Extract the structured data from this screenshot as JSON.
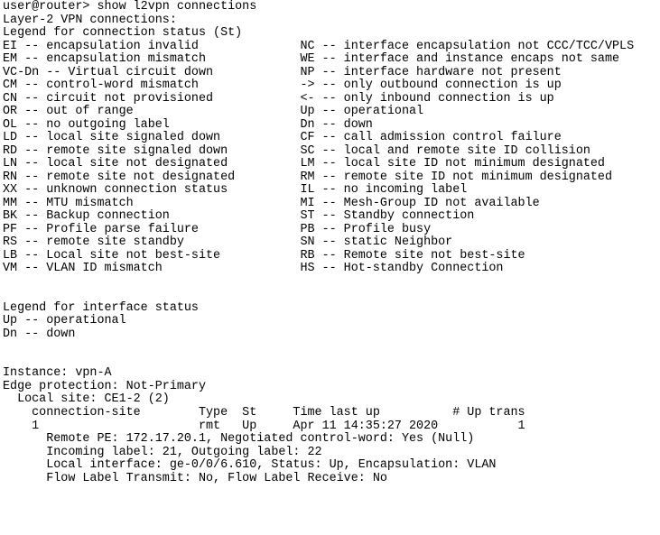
{
  "terminal": {
    "prompt": "user@router>",
    "command": "show l2vpn connections",
    "title": "Layer-2 VPN connections:",
    "lines": [
      "user@router> show l2vpn connections",
      "Layer-2 VPN connections:",
      "Legend for connection status (St)",
      "EI -- encapsulation invalid              NC -- interface encapsulation not CCC/TCC/VPLS",
      "EM -- encapsulation mismatch             WE -- interface and instance encaps not same",
      "VC-Dn -- Virtual circuit down            NP -- interface hardware not present",
      "CM -- control-word mismatch              -> -- only outbound connection is up",
      "CN -- circuit not provisioned            <- -- only inbound connection is up",
      "OR -- out of range                       Up -- operational",
      "OL -- no outgoing label                  Dn -- down",
      "LD -- local site signaled down           CF -- call admission control failure",
      "RD -- remote site signaled down          SC -- local and remote site ID collision",
      "LN -- local site not designated          LM -- local site ID not minimum designated",
      "RN -- remote site not designated         RM -- remote site ID not minimum designated",
      "XX -- unknown connection status          IL -- no incoming label",
      "MM -- MTU mismatch                       MI -- Mesh-Group ID not available",
      "BK -- Backup connection                  ST -- Standby connection",
      "PF -- Profile parse failure              PB -- Profile busy",
      "RS -- remote site standby                SN -- static Neighbor",
      "LB -- Local site not best-site           RB -- Remote site not best-site",
      "VM -- VLAN ID mismatch                   HS -- Hot-standby Connection",
      "",
      "",
      "Legend for interface status",
      "Up -- operational",
      "Dn -- down",
      "",
      "",
      "Instance: vpn-A",
      "Edge protection: Not-Primary",
      "  Local site: CE1-2 (2)",
      "    connection-site        Type  St     Time last up          # Up trans",
      "    1                      rmt   Up     Apr 11 14:35:27 2020           1",
      "      Remote PE: 172.17.20.1, Negotiated control-word: Yes (Null)",
      "      Incoming label: 21, Outgoing label: 22",
      "      Local interface: ge-0/0/6.610, Status: Up, Encapsulation: VLAN",
      "      Flow Label Transmit: No, Flow Label Receive: No"
    ]
  },
  "connection_status_legend": {
    "heading": "Legend for connection status (St)",
    "left_column": [
      {
        "code": "EI",
        "description": "encapsulation invalid"
      },
      {
        "code": "EM",
        "description": "encapsulation mismatch"
      },
      {
        "code": "VC-Dn",
        "description": "Virtual circuit down"
      },
      {
        "code": "CM",
        "description": "control-word mismatch"
      },
      {
        "code": "CN",
        "description": "circuit not provisioned"
      },
      {
        "code": "OR",
        "description": "out of range"
      },
      {
        "code": "OL",
        "description": "no outgoing label"
      },
      {
        "code": "LD",
        "description": "local site signaled down"
      },
      {
        "code": "RD",
        "description": "remote site signaled down"
      },
      {
        "code": "LN",
        "description": "local site not designated"
      },
      {
        "code": "RN",
        "description": "remote site not designated"
      },
      {
        "code": "XX",
        "description": "unknown connection status"
      },
      {
        "code": "MM",
        "description": "MTU mismatch"
      },
      {
        "code": "BK",
        "description": "Backup connection"
      },
      {
        "code": "PF",
        "description": "Profile parse failure"
      },
      {
        "code": "RS",
        "description": "remote site standby"
      },
      {
        "code": "LB",
        "description": "Local site not best-site"
      },
      {
        "code": "VM",
        "description": "VLAN ID mismatch"
      }
    ],
    "right_column": [
      {
        "code": "NC",
        "description": "interface encapsulation not CCC/TCC/VPLS"
      },
      {
        "code": "WE",
        "description": "interface and instance encaps not same"
      },
      {
        "code": "NP",
        "description": "interface hardware not present"
      },
      {
        "code": "->",
        "description": "only outbound connection is up"
      },
      {
        "code": "<-",
        "description": "only inbound connection is up"
      },
      {
        "code": "Up",
        "description": "operational"
      },
      {
        "code": "Dn",
        "description": "down"
      },
      {
        "code": "CF",
        "description": "call admission control failure"
      },
      {
        "code": "SC",
        "description": "local and remote site ID collision"
      },
      {
        "code": "LM",
        "description": "local site ID not minimum designated"
      },
      {
        "code": "RM",
        "description": "remote site ID not minimum designated"
      },
      {
        "code": "IL",
        "description": "no incoming label"
      },
      {
        "code": "MI",
        "description": "Mesh-Group ID not available"
      },
      {
        "code": "ST",
        "description": "Standby connection"
      },
      {
        "code": "PB",
        "description": "Profile busy"
      },
      {
        "code": "SN",
        "description": "static Neighbor"
      },
      {
        "code": "RB",
        "description": "Remote site not best-site"
      },
      {
        "code": "HS",
        "description": "Hot-standby Connection"
      }
    ]
  },
  "interface_status_legend": {
    "heading": "Legend for interface status",
    "entries": [
      {
        "code": "Up",
        "description": "operational"
      },
      {
        "code": "Dn",
        "description": "down"
      }
    ]
  },
  "instance": {
    "name_label": "Instance:",
    "name": "vpn-A",
    "edge_protection_label": "Edge protection:",
    "edge_protection": "Not-Primary",
    "local_site_label": "Local site:",
    "local_site": "CE1-2 (2)",
    "table": {
      "headers": [
        "connection-site",
        "Type",
        "St",
        "Time last up",
        "# Up trans"
      ],
      "rows": [
        {
          "connection_site": "1",
          "type": "rmt",
          "st": "Up",
          "time_last_up": "Apr 11 14:35:27 2020",
          "up_trans": "1"
        }
      ]
    },
    "details": [
      "Remote PE: 172.17.20.1, Negotiated control-word: Yes (Null)",
      "Incoming label: 21, Outgoing label: 22",
      "Local interface: ge-0/0/6.610, Status: Up, Encapsulation: VLAN",
      "Flow Label Transmit: No, Flow Label Receive: No"
    ]
  },
  "colors": {
    "background": "#ffffff",
    "foreground": "#000000"
  }
}
